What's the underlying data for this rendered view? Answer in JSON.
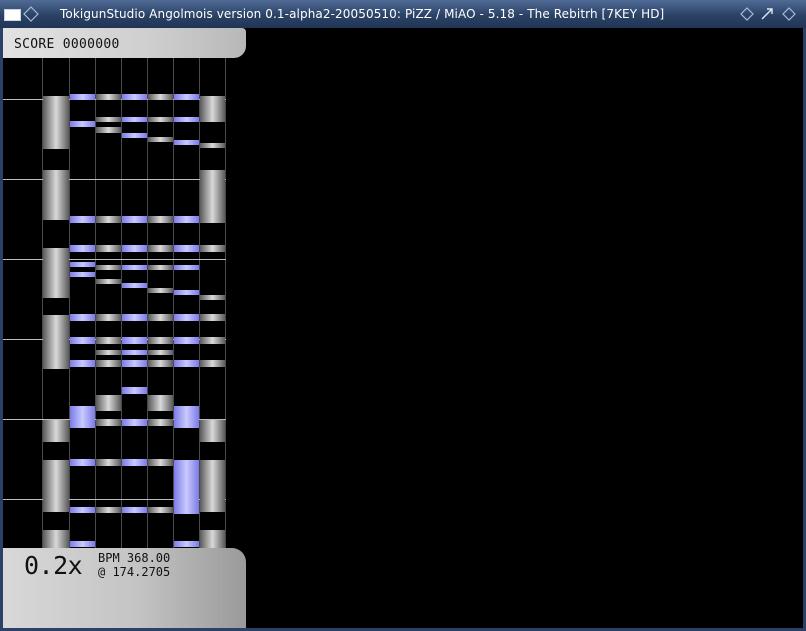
{
  "window": {
    "title": "TokigunStudio Angolmois version 0.1-alpha2-20050510: PiZZ / MiAO - 5.18 - The Rebitrh [7KEY HD]"
  },
  "hud": {
    "score": "SCORE 0000000",
    "speed": "0.2x",
    "bpm": "BPM 368.00",
    "position": "@ 174.2705"
  },
  "colors": {
    "note_blue": "#9d9dff",
    "note_grey": "#9a9a9a",
    "lane_line": "#555555",
    "measure_line": "#bdbdbd",
    "panel": "#cccccc"
  },
  "playfield": {
    "lanes": [
      "scratch",
      "key1",
      "key2",
      "key3",
      "key4",
      "key5",
      "key6",
      "key7"
    ],
    "measure_lines": 6
  }
}
